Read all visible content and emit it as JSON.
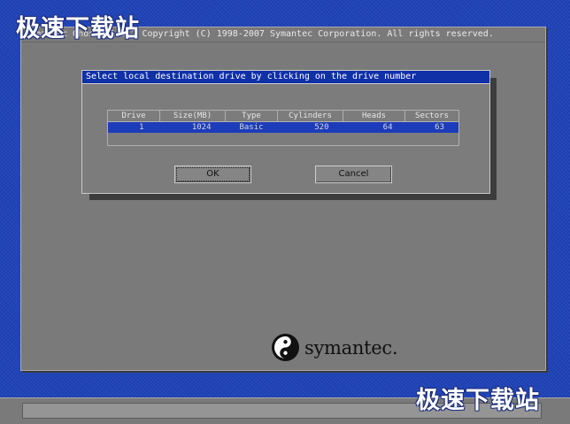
{
  "watermark": {
    "top": "极速下载站",
    "bottom": "极速下载站"
  },
  "window": {
    "title": "Symantec Ghost 11.0.2   Copyright (C) 1998-2007 Symantec Corporation. All rights reserved."
  },
  "dialog": {
    "title": "Select local destination drive by clicking on the drive number",
    "columns": [
      "Drive",
      "Size(MB)",
      "Type",
      "Cylinders",
      "Heads",
      "Sectors"
    ],
    "rows": [
      {
        "drive": "1",
        "size": "1024",
        "type": "Basic",
        "cylinders": "520",
        "heads": "64",
        "sectors": "63",
        "selected": true
      }
    ],
    "ok_label": "OK",
    "cancel_label": "Cancel"
  },
  "logo": {
    "text": "symantec.",
    "icon": "symantec-logo-icon"
  },
  "colors": {
    "desktop": "#1f43b8",
    "selection": "#1c3cba",
    "window": "#7a7a7a"
  }
}
